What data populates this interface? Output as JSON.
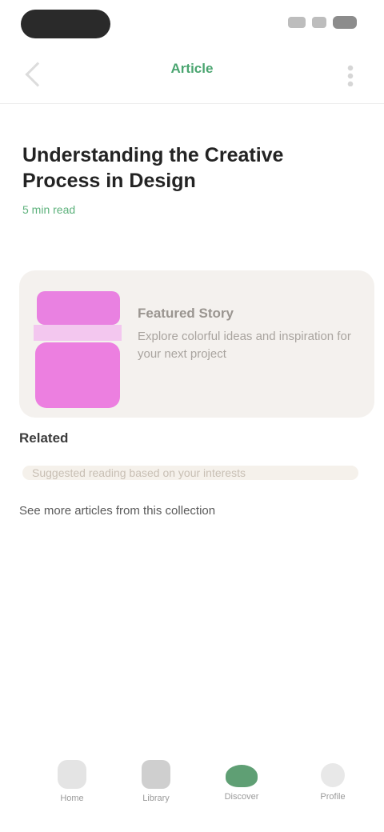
{
  "header": {
    "title": "Article"
  },
  "article": {
    "title": "Understanding the Creative Process in Design",
    "meta": "5 min read"
  },
  "feature_card": {
    "title": "Featured Story",
    "description": "Explore colorful ideas and inspiration for your next project"
  },
  "section": {
    "heading": "Related",
    "line_text": "Suggested reading based on your interests",
    "subtext": "See more articles from this collection"
  },
  "tabs": [
    {
      "label": "Home",
      "icon": "home-icon"
    },
    {
      "label": "Library",
      "icon": "library-icon"
    },
    {
      "label": "Discover",
      "icon": "leaf-icon"
    },
    {
      "label": "Profile",
      "icon": "profile-icon"
    }
  ],
  "colors": {
    "accent": "#4aa570",
    "card_bg": "#f4f1ee",
    "thumb": "#ec7fe0",
    "active_tab": "#5f9f74"
  }
}
